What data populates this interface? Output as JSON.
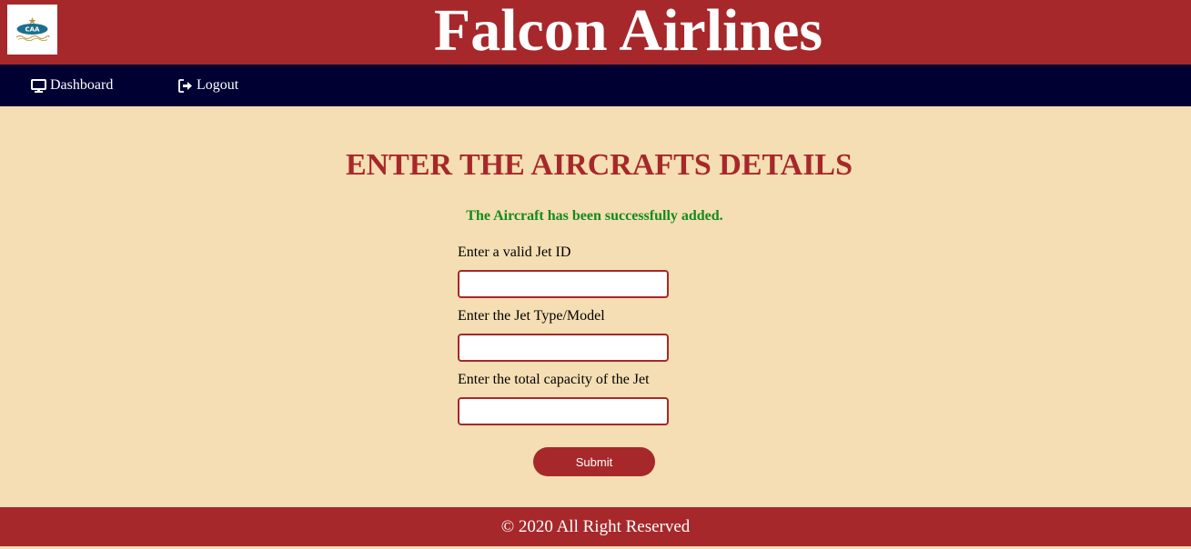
{
  "header": {
    "title": "Falcon Airlines",
    "logo_icon": "caa-logo-icon",
    "logo_text": "CAA"
  },
  "nav": {
    "items": [
      {
        "label": "Dashboard",
        "icon": "monitor-icon"
      },
      {
        "label": "Logout",
        "icon": "logout-icon"
      }
    ]
  },
  "form": {
    "title": "ENTER THE AIRCRAFTS DETAILS",
    "success_message": "The Aircraft has been successfully added.",
    "fields": [
      {
        "label": "Enter a valid Jet ID",
        "value": ""
      },
      {
        "label": "Enter the Jet Type/Model",
        "value": ""
      },
      {
        "label": "Enter the total capacity of the Jet",
        "value": ""
      }
    ],
    "submit_label": "Submit"
  },
  "footer": {
    "text": "© 2020 All Right Reserved"
  },
  "colors": {
    "brand_red": "#a6282b",
    "nav_navy": "#000033",
    "background": "#f5deb3",
    "success_green": "#138a1c"
  }
}
